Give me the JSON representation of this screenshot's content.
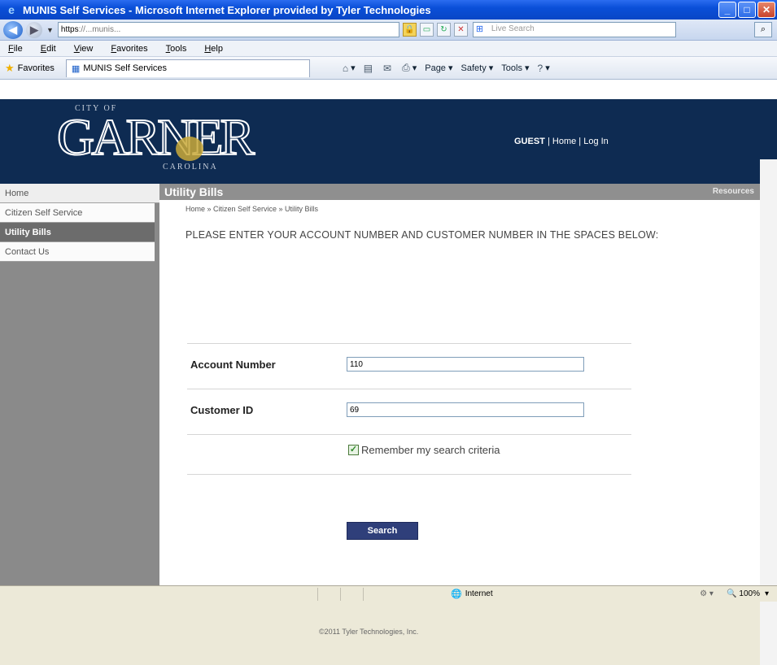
{
  "window": {
    "title": "MUNIS Self Services - Microsoft Internet Explorer provided by Tyler Technologies",
    "icon": "ie-icon"
  },
  "address_bar": {
    "url_scheme": "https",
    "url_text": "://...munis...",
    "live_search_placeholder": "Live Search"
  },
  "menu": [
    "File",
    "Edit",
    "View",
    "Favorites",
    "Tools",
    "Help"
  ],
  "favorites_bar": {
    "favorites_label": "Favorites",
    "tab_title": "MUNIS Self Services",
    "commands": {
      "page": "Page",
      "safety": "Safety",
      "tools": "Tools"
    }
  },
  "header": {
    "logo_small_top": "CITY OF",
    "logo_word": "GARNER",
    "logo_small_bottom": "CAROLINA",
    "guest": "GUEST",
    "home_link": "Home",
    "login_link": "Log In",
    "separator": "|"
  },
  "sidebar": {
    "items": [
      {
        "label": "Home",
        "active": false
      },
      {
        "label": "Citizen Self Service",
        "active": false
      },
      {
        "label": "Utility Bills",
        "active": true
      },
      {
        "label": "Contact Us",
        "active": false
      }
    ]
  },
  "content": {
    "section_title": "Utility Bills",
    "resources_label": "Resources",
    "breadcrumb": "Home » Citizen Self Service » Utility Bills",
    "instruction": "PLEASE ENTER YOUR ACCOUNT NUMBER AND CUSTOMER NUMBER IN THE SPACES BELOW:",
    "fields": {
      "account_label": "Account Number",
      "account_value": "110",
      "customer_label": "Customer ID",
      "customer_value": "69"
    },
    "remember_label": "Remember my search criteria",
    "remember_checked": true,
    "search_button": "Search",
    "copyright": "©2011 Tyler Technologies, Inc."
  },
  "status_bar": {
    "zone": "Internet",
    "zoom": "100%"
  },
  "colors": {
    "header_bg": "#0e2b52",
    "sidebar_bg": "#8a8a8a",
    "active_item_bg": "#6c6c6c",
    "section_bar_bg": "#8f8f8f",
    "search_button_bg": "#2f3f7a"
  }
}
